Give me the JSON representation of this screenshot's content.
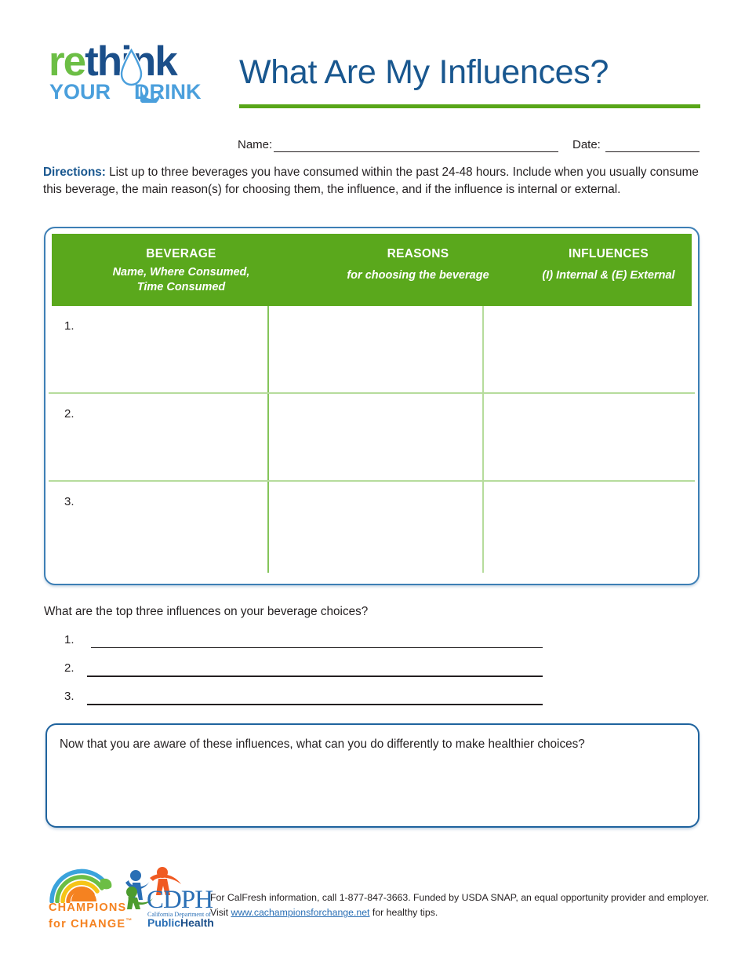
{
  "header": {
    "logo": {
      "line1_part1": "re",
      "line1_part2": "think",
      "line2_part1": "YOUR",
      "line2_part2": "DRINK",
      "drop_icon": "water-drop-icon",
      "smile_icon": "crescent-smile-icon"
    },
    "title": "What Are My Influences?"
  },
  "name_date": {
    "name_label": "Name:",
    "date_label": "Date:"
  },
  "directions": {
    "label": "Directions:",
    "body": " List up to three beverages you have consumed within the past 24-48 hours. Include when you usually consume this beverage, the main reason(s) for choosing them, the influence, and if the influence is internal or external."
  },
  "table": {
    "columns": [
      {
        "title": "BEVERAGE",
        "subtitle_line1": "Name, Where Consumed,",
        "subtitle_line2": "Time Consumed"
      },
      {
        "title": "REASONS",
        "subtitle_line1": "for choosing the beverage",
        "subtitle_line2": ""
      },
      {
        "title": "INFLUENCES",
        "subtitle_line1": "(I) Internal & (E) External",
        "subtitle_line2": ""
      }
    ],
    "rows": [
      {
        "number": "1.",
        "beverage": "",
        "reasons": "",
        "influences": ""
      },
      {
        "number": "2.",
        "beverage": "",
        "reasons": "",
        "influences": ""
      },
      {
        "number": "3.",
        "beverage": "",
        "reasons": "",
        "influences": ""
      }
    ]
  },
  "top_three": {
    "question": "What are the top three influences on your beverage choices?",
    "answers": [
      {
        "number": "1.",
        "value": ""
      },
      {
        "number": "2.",
        "value": ""
      },
      {
        "number": "3.",
        "value": ""
      }
    ]
  },
  "reflection": {
    "prompt": "Now that you are aware of these influences, what can you do differently to make healthier choices?",
    "value": ""
  },
  "footer": {
    "champions_logo": {
      "line1": "CHAMPIONS",
      "line2": "for CHANGE",
      "trademark": "™",
      "icon": "rainbow-arcs-orange-sun-icon"
    },
    "cdph_logo": {
      "acronym": "CDPH",
      "subtitle": "California Department of",
      "public": "Public",
      "health": "Health",
      "icon": "three-figures-icon"
    },
    "text_line1": "For CalFresh information, call 1-877-847-3663. Funded by USDA SNAP, an equal opportunity provider and employer.",
    "text_line2_prefix": "Visit ",
    "text_line2_link": "www.cachampionsforchange.net",
    "text_line2_suffix": " for healthy tips."
  },
  "colors": {
    "brand_blue": "#19578f",
    "brand_green": "#58a618",
    "header_green": "#5aa81c",
    "light_green": "#b6dc9c",
    "mid_green": "#84c45a",
    "card_border_blue": "#3d7fb5",
    "orange": "#f58220",
    "link_blue": "#2a6fb5"
  }
}
